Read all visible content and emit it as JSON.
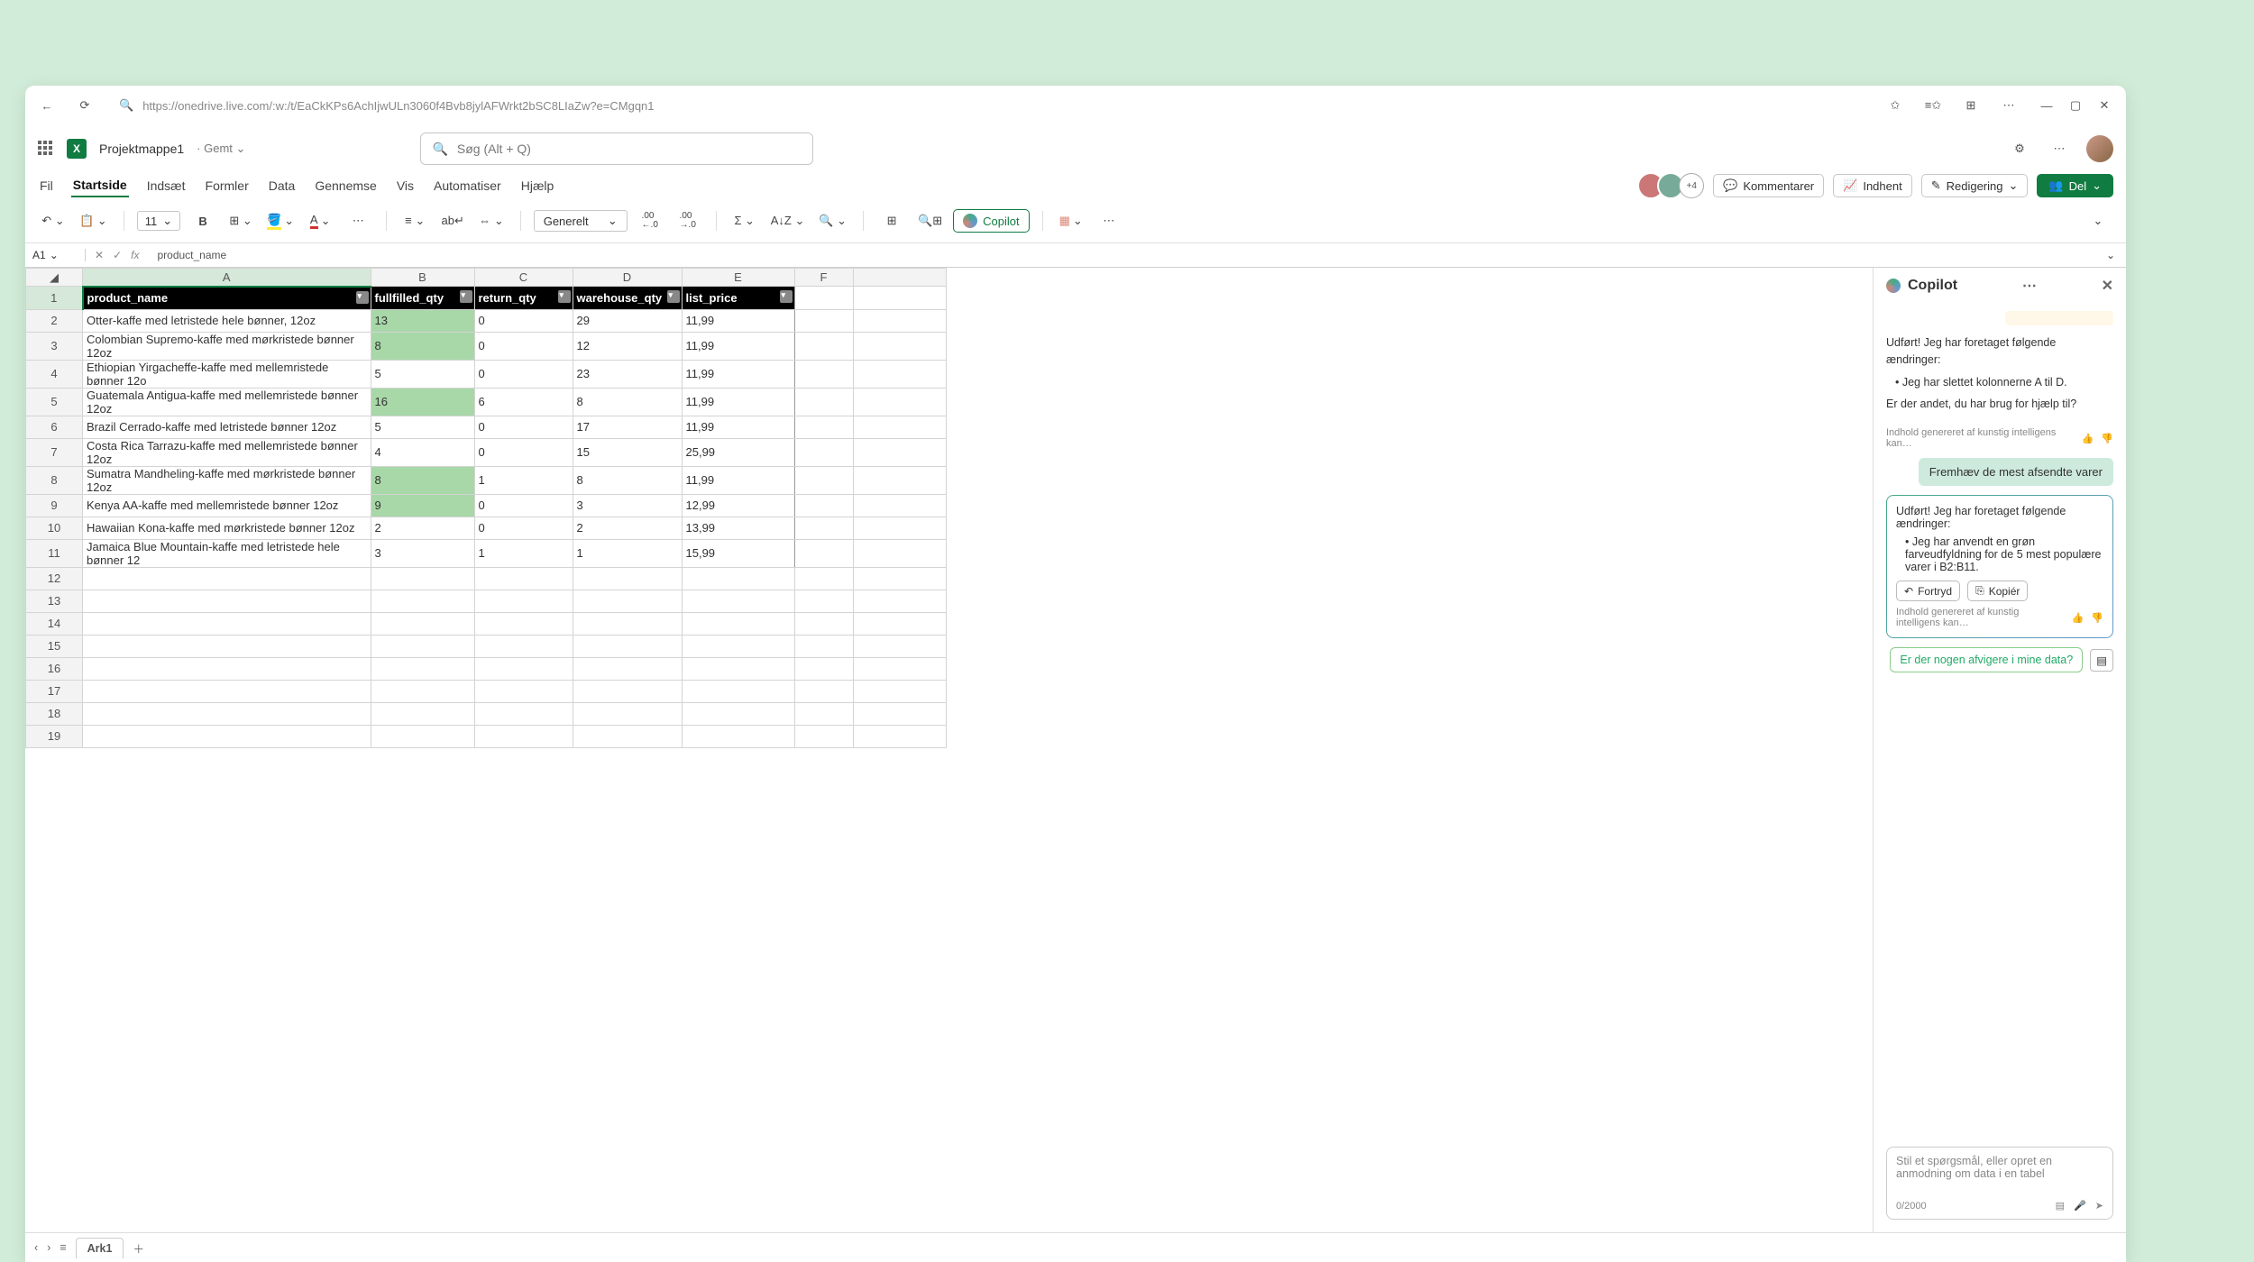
{
  "browser": {
    "url": "https://onedrive.live.com/:w:/t/EaCkKPs6AchIjwULn3060f4Bvb8jylAFWrkt2bSC8LIaZw?e=CMgqn1"
  },
  "app": {
    "doc_title": "Projektmappe1",
    "saved_label": "Gemt",
    "search_placeholder": "Søg (Alt + Q)"
  },
  "tabs": {
    "fil": "Fil",
    "start": "Startside",
    "indsaet": "Indsæt",
    "formler": "Formler",
    "data": "Data",
    "gennemse": "Gennemse",
    "vis": "Vis",
    "automatiser": "Automatiser",
    "hjaelp": "Hjælp"
  },
  "presence_count": "+4",
  "ribbon_right": {
    "kommentarer": "Kommentarer",
    "indhent": "Indhent",
    "redigering": "Redigering",
    "del": "Del"
  },
  "toolbar": {
    "font_size": "11",
    "number_format": "Generelt",
    "copilot": "Copilot"
  },
  "namebox": "A1",
  "formula": "product_name",
  "columns": [
    "",
    "A",
    "B",
    "C",
    "D",
    "E",
    "F"
  ],
  "headers": {
    "a": "product_name",
    "b": "fullfilled_qty",
    "c": "return_qty",
    "d": "warehouse_qty",
    "e": "list_price"
  },
  "rows": [
    {
      "n": "2",
      "a": "Otter-kaffe med letristede hele bønner, 12oz",
      "b": "13",
      "c": "0",
      "d": "29",
      "e": "11,99",
      "hl": true
    },
    {
      "n": "3",
      "a": "Colombian Supremo-kaffe med mørkristede bønner 12oz",
      "b": "8",
      "c": "0",
      "d": "12",
      "e": "11,99",
      "hl": true
    },
    {
      "n": "4",
      "a": "Ethiopian Yirgacheffe-kaffe med mellemristede bønner 12o",
      "b": "5",
      "c": "0",
      "d": "23",
      "e": "11,99",
      "hl": false
    },
    {
      "n": "5",
      "a": "Guatemala Antigua-kaffe med mellemristede bønner 12oz",
      "b": "16",
      "c": "6",
      "d": "8",
      "e": "11,99",
      "hl": true
    },
    {
      "n": "6",
      "a": "Brazil Cerrado-kaffe med letristede bønner 12oz",
      "b": "5",
      "c": "0",
      "d": "17",
      "e": "11,99",
      "hl": false
    },
    {
      "n": "7",
      "a": "Costa Rica Tarrazu-kaffe med mellemristede bønner 12oz",
      "b": "4",
      "c": "0",
      "d": "15",
      "e": "25,99",
      "hl": false
    },
    {
      "n": "8",
      "a": "Sumatra Mandheling-kaffe med mørkristede bønner 12oz",
      "b": "8",
      "c": "1",
      "d": "8",
      "e": "11,99",
      "hl": true
    },
    {
      "n": "9",
      "a": "Kenya AA-kaffe med mellemristede bønner 12oz",
      "b": "9",
      "c": "0",
      "d": "3",
      "e": "12,99",
      "hl": true
    },
    {
      "n": "10",
      "a": "Hawaiian Kona-kaffe med mørkristede bønner 12oz",
      "b": "2",
      "c": "0",
      "d": "2",
      "e": "13,99",
      "hl": false
    },
    {
      "n": "11",
      "a": "Jamaica Blue Mountain-kaffe med letristede hele bønner 12",
      "b": "3",
      "c": "1",
      "d": "1",
      "e": "15,99",
      "hl": false
    }
  ],
  "empty_rows": [
    "12",
    "13",
    "14",
    "15",
    "16",
    "17",
    "18",
    "19"
  ],
  "sheet_tab": "Ark1",
  "copilot": {
    "title": "Copilot",
    "msg1_intro": "Udført! Jeg har foretaget følgende ændringer:",
    "msg1_bullet": "Jeg har slettet kolonnerne A til D.",
    "msg1_followup": "Er der andet, du har brug for hjælp til?",
    "ai_note": "Indhold genereret af kunstig intelligens kan…",
    "user_msg": "Fremhæv de mest afsendte varer",
    "msg2_intro": "Udført! Jeg har foretaget følgende ændringer:",
    "msg2_bullet": "Jeg har anvendt en grøn farveudfyldning for de 5 mest populære varer i B2:B11.",
    "undo": "Fortryd",
    "copy": "Kopiér",
    "suggestion": "Er der nogen afvigere i mine data?",
    "input_placeholder": "Stil et spørgsmål, eller opret en anmodning om data i en tabel",
    "counter": "0/2000"
  }
}
